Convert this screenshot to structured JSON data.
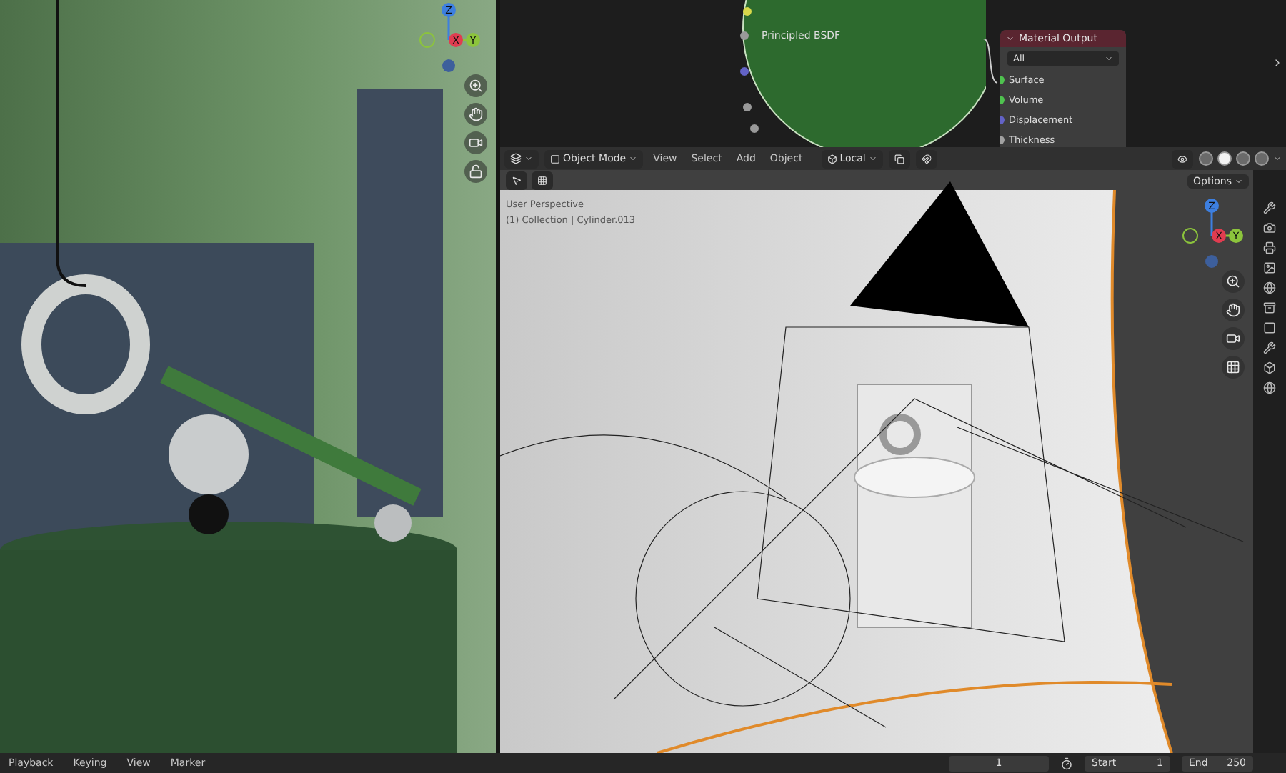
{
  "left_viewport": {
    "gizmo": [
      "Z",
      "X",
      "Y"
    ]
  },
  "node_editor": {
    "shader_node": {
      "title": "Principled BSDF"
    },
    "output_node": {
      "title": "Material Output",
      "target": "All",
      "sockets": [
        {
          "name": "Surface",
          "color": "#4fc24f"
        },
        {
          "name": "Volume",
          "color": "#4fc24f"
        },
        {
          "name": "Displacement",
          "color": "#6363c7"
        },
        {
          "name": "Thickness",
          "color": "#a1a1a1"
        }
      ]
    }
  },
  "viewport_header": {
    "mode": "Object Mode",
    "menus": [
      "View",
      "Select",
      "Add",
      "Object"
    ],
    "orientation": "Local",
    "shading": [
      {
        "selected": false
      },
      {
        "selected": true
      },
      {
        "selected": false
      },
      {
        "selected": false
      }
    ]
  },
  "viewport": {
    "options": "Options",
    "overlay_lines": [
      "User Perspective",
      "(1) Collection | Cylinder.013"
    ],
    "gizmo": [
      "Z",
      "X",
      "Y"
    ]
  },
  "timeline": {
    "menus": [
      "Playback",
      "Keying",
      "View",
      "Marker"
    ],
    "current_frame": "1",
    "start_label": "Start",
    "start": "1",
    "end_label": "End",
    "end": "250"
  }
}
